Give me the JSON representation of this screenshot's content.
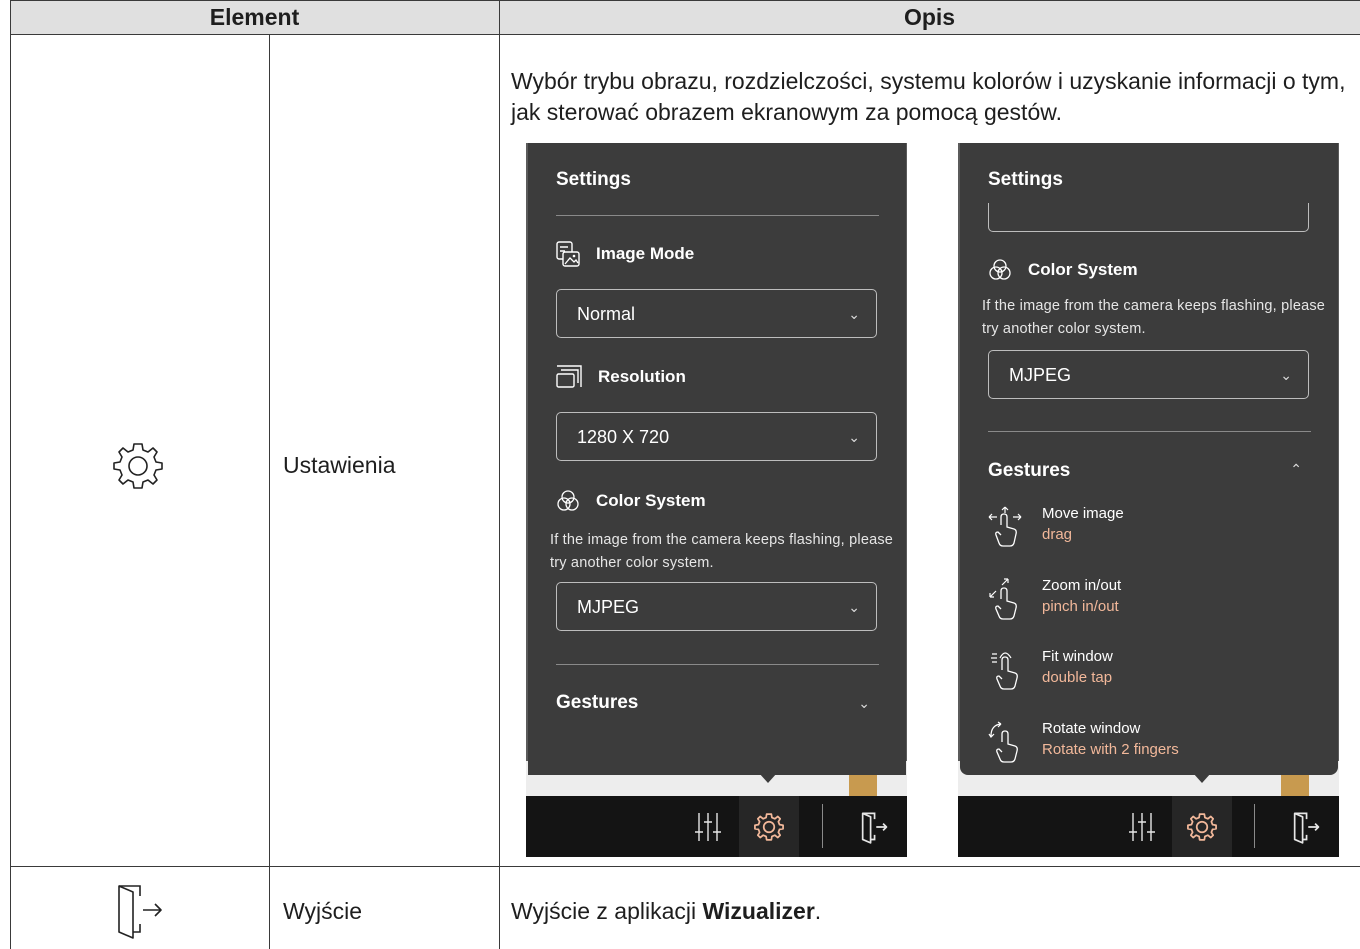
{
  "table": {
    "header_element": "Element",
    "header_opis": "Opis",
    "rows": [
      {
        "icon": "gear-icon",
        "name": "Ustawienia",
        "description": "Wybór trybu obrazu, rozdzielczości, systemu kolorów i uzyskanie informacji o tym, jak sterować obrazem ekranowym za pomocą gestów."
      },
      {
        "icon": "exit-door-icon",
        "name": "Wyjście",
        "description_prefix": "Wyjście z aplikacji ",
        "description_bold": "Wizualizer",
        "description_suffix": "."
      }
    ]
  },
  "screen1": {
    "title": "Settings",
    "image_mode_label": "Image Mode",
    "image_mode_value": "Normal",
    "resolution_label": "Resolution",
    "resolution_value": "1280 X 720",
    "color_system_label": "Color System",
    "color_hint": "If the image from the camera keeps flashing, please try another color system.",
    "color_value": "MJPEG",
    "gestures_label": "Gestures",
    "gestures_state": "collapsed"
  },
  "screen2": {
    "title": "Settings",
    "color_system_label": "Color System",
    "color_hint": "If the image from the camera keeps flashing, please try another color system.",
    "color_value": "MJPEG",
    "gestures_label": "Gestures",
    "gestures_state": "expanded",
    "gestures": [
      {
        "name": "Move image",
        "action": "drag",
        "icon": "move-gesture-icon"
      },
      {
        "name": "Zoom in/out",
        "action": "pinch in/out",
        "icon": "zoom-gesture-icon"
      },
      {
        "name": "Fit window",
        "action": "double tap",
        "icon": "double-tap-gesture-icon"
      },
      {
        "name": "Rotate window",
        "action": "Rotate with 2 fingers",
        "icon": "rotate-gesture-icon"
      }
    ]
  },
  "colors": {
    "panel_bg": "#3c3c3c",
    "toolbar_bg": "#141414",
    "accent_orange": "#f2b89a",
    "header_gray": "#e0e0e0"
  }
}
